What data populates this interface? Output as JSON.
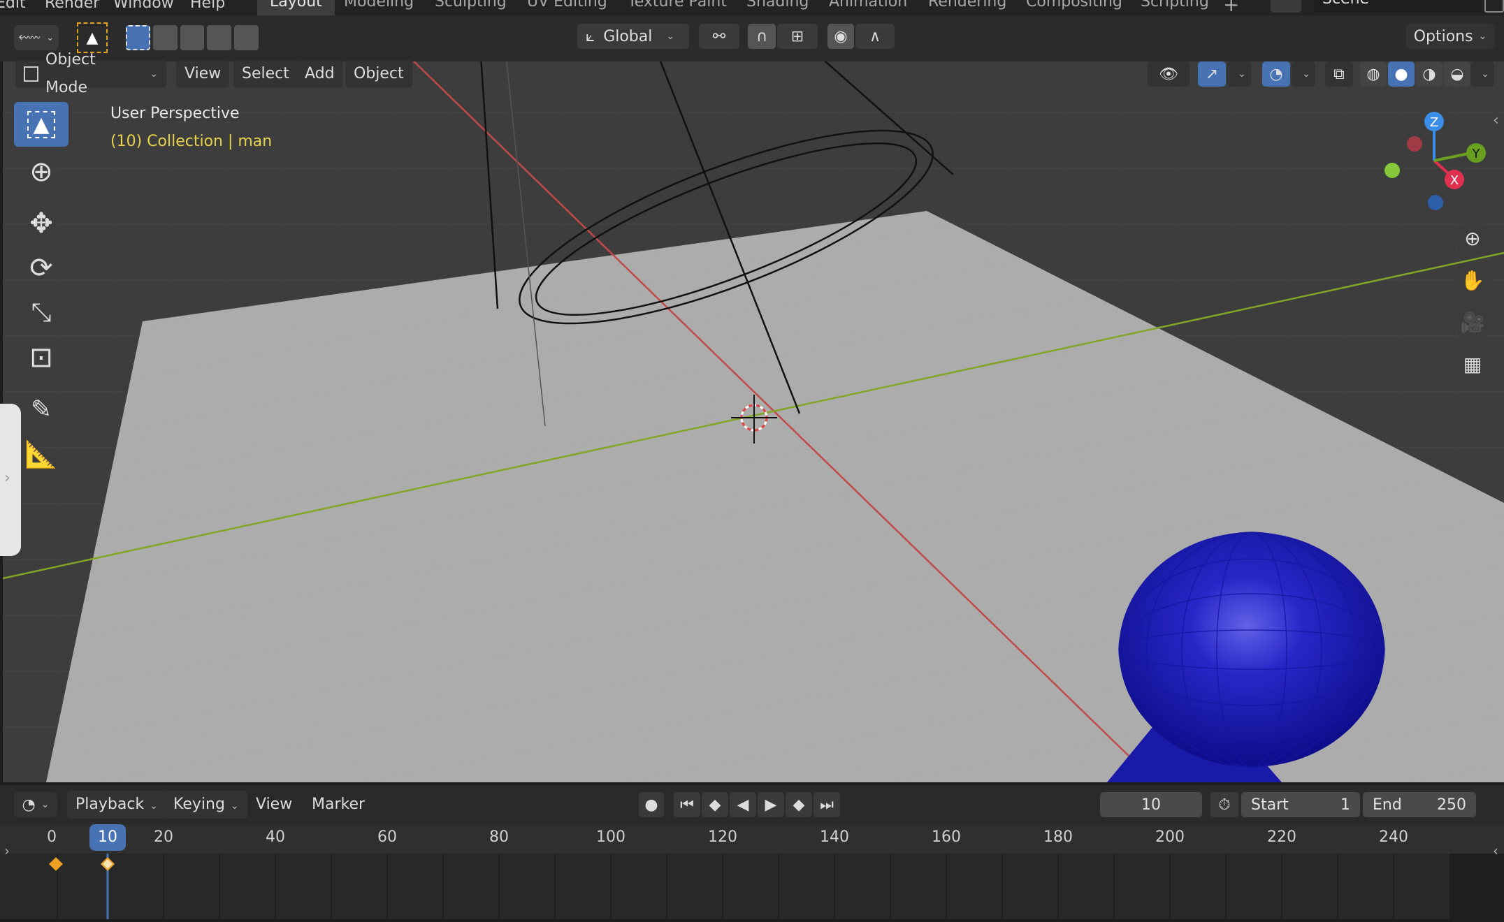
{
  "top_menu": [
    "Edit",
    "Render",
    "Window",
    "Help"
  ],
  "workspace_tabs": [
    {
      "label": "Layout",
      "active": true
    },
    {
      "label": "Modeling"
    },
    {
      "label": "Sculpting"
    },
    {
      "label": "UV Editing"
    },
    {
      "label": "Texture Paint"
    },
    {
      "label": "Shading"
    },
    {
      "label": "Animation"
    },
    {
      "label": "Rendering"
    },
    {
      "label": "Compositing"
    },
    {
      "label": "Scripting"
    }
  ],
  "scene_label": "Scene",
  "header": {
    "transform_orientation": "Global",
    "options_label": "Options",
    "mode": "Object Mode",
    "menus": [
      "View",
      "Select",
      "Add",
      "Object"
    ]
  },
  "viewport": {
    "perspective_label": "User Perspective",
    "collection_label": "(10) Collection | man",
    "gizmo_axes": {
      "x": "X",
      "y": "Y",
      "z": "Z"
    },
    "colors": {
      "x_axis": "#c04a4a",
      "y_axis": "#84a428",
      "accent": "#4772b3",
      "sphere": "#1f1fb8"
    }
  },
  "timeline": {
    "menus": [
      "Playback",
      "Keying",
      "View",
      "Marker"
    ],
    "current_frame": "10",
    "start_label": "Start",
    "start_value": "1",
    "end_label": "End",
    "end_value": "250",
    "ruler": [
      "0",
      "10",
      "20",
      "40",
      "60",
      "80",
      "100",
      "120",
      "140",
      "160",
      "180",
      "200",
      "220",
      "240"
    ]
  }
}
